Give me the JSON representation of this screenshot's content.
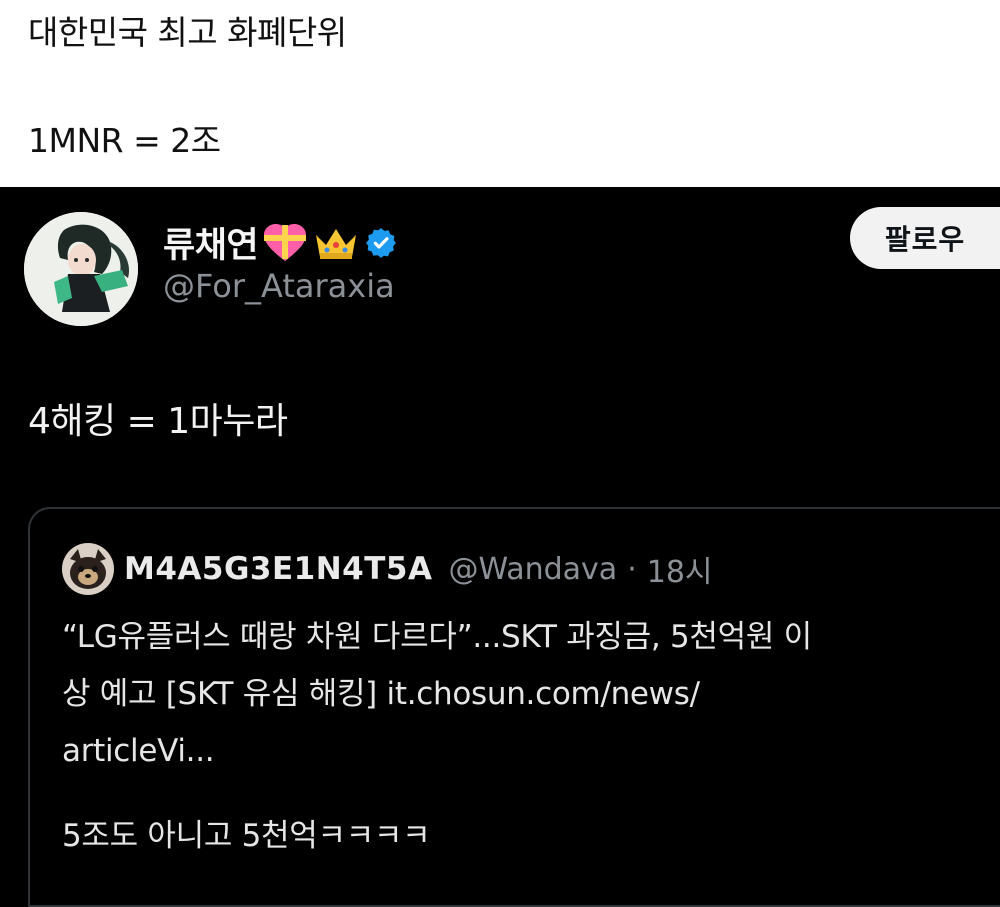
{
  "caption": {
    "line1": "대한민국 최고 화폐단위",
    "line2": "1MNR = 2조"
  },
  "tweet": {
    "author_name": "류채연",
    "author_emojis": [
      "gift-heart-icon",
      "crown-icon",
      "verified-badge-icon"
    ],
    "handle": "@For_Ataraxia",
    "follow_label": "팔로우",
    "text": "4해킹 = 1마누라",
    "quote": {
      "author_name": "M4A5G3E1N4T5A",
      "handle": "@Wandava",
      "separator": "·",
      "time": "18시",
      "body_line1": "“LG유플러스 때랑 차원 다르다”...SKT 과징금, 5천억원 이",
      "body_line2": "상 예고 [SKT 유심 해킹] it.chosun.com/news/",
      "body_line3": "articleVi...",
      "body_line4": "5조도 아니고 5천억ㅋㅋㅋㅋ"
    }
  },
  "colors": {
    "accent_verified": "#1d9bf0",
    "background": "#000000",
    "secondary_text": "#8b9196"
  }
}
